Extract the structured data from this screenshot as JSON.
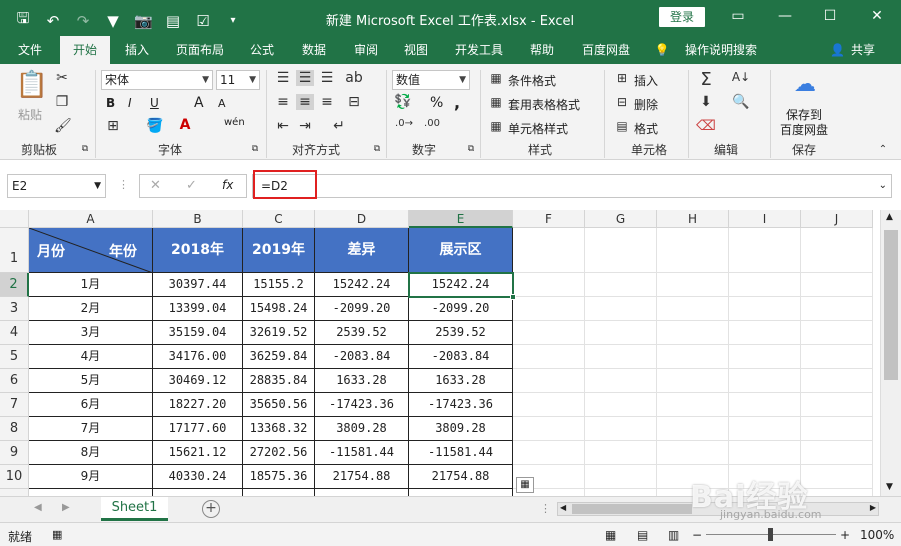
{
  "titlebar": {
    "title": "新建 Microsoft Excel 工作表.xlsx  -  Excel",
    "login": "登录",
    "qat_icons": [
      "save-icon",
      "undo-icon",
      "redo-icon",
      "filter-icon",
      "camera-icon",
      "form-icon",
      "checkbox-icon",
      "customize-icon"
    ]
  },
  "tabs": [
    "文件",
    "开始",
    "插入",
    "页面布局",
    "公式",
    "数据",
    "审阅",
    "视图",
    "开发工具",
    "帮助",
    "百度网盘",
    "操作说明搜索",
    "共享"
  ],
  "ribbon": {
    "clipboard": {
      "label": "剪贴板",
      "paste": "粘贴"
    },
    "font": {
      "label": "字体",
      "font_name": "宋体",
      "font_size": "11",
      "bold": "B",
      "italic": "I",
      "underline": "U",
      "grow": "A",
      "shrink": "A",
      "phonetic": "wén"
    },
    "align": {
      "label": "对齐方式"
    },
    "number": {
      "label": "数字",
      "format": "数值",
      "percent": "%",
      "comma": ","
    },
    "styles": {
      "label": "样式",
      "cond": "条件格式",
      "table": "套用表格格式",
      "cell": "单元格样式"
    },
    "cells": {
      "label": "单元格",
      "insert": "插入",
      "delete": "删除",
      "format": "格式"
    },
    "edit": {
      "label": "编辑"
    },
    "save": {
      "label": "保存",
      "button": "保存到\n百度网盘",
      "line1": "保存到",
      "line2": "百度网盘"
    }
  },
  "formula_bar": {
    "name_box": "E2",
    "formula": "=D2",
    "fx": "fx"
  },
  "columns": [
    "A",
    "B",
    "C",
    "D",
    "E",
    "F",
    "G",
    "H",
    "I",
    "J"
  ],
  "rows": [
    "1",
    "2",
    "3",
    "4",
    "5",
    "6",
    "7",
    "8",
    "9",
    "10"
  ],
  "table": {
    "header_month": "月份",
    "header_year": "年份",
    "headers": [
      "2018年",
      "2019年",
      "差异",
      "展示区"
    ],
    "data": [
      [
        "1月",
        "30397.44",
        "15155.2",
        "15242.24",
        "15242.24"
      ],
      [
        "2月",
        "13399.04",
        "15498.24",
        "-2099.20",
        "-2099.20"
      ],
      [
        "3月",
        "35159.04",
        "32619.52",
        "2539.52",
        "2539.52"
      ],
      [
        "4月",
        "34176.00",
        "36259.84",
        "-2083.84",
        "-2083.84"
      ],
      [
        "5月",
        "30469.12",
        "28835.84",
        "1633.28",
        "1633.28"
      ],
      [
        "6月",
        "18227.20",
        "35650.56",
        "-17423.36",
        "-17423.36"
      ],
      [
        "7月",
        "17177.60",
        "13368.32",
        "3809.28",
        "3809.28"
      ],
      [
        "8月",
        "15621.12",
        "27202.56",
        "-11581.44",
        "-11581.44"
      ],
      [
        "9月",
        "40330.24",
        "18575.36",
        "21754.88",
        "21754.88"
      ]
    ]
  },
  "sheets": [
    "Sheet1"
  ],
  "status": {
    "ready": "就绪",
    "zoom": "100%"
  },
  "watermark": {
    "main": "Bai经验",
    "sub": "jingyan.baidu.com"
  },
  "colors": {
    "excel_green": "#217346",
    "header_blue": "#4472c4",
    "highlight_red": "#e02020"
  }
}
